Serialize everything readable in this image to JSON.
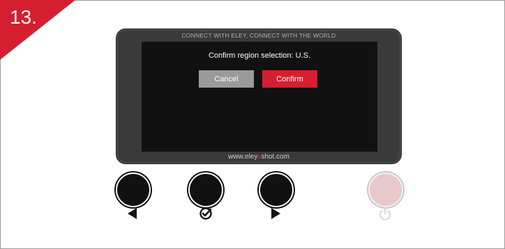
{
  "step": {
    "number": "13."
  },
  "device": {
    "top_text": "CONNECT WITH ELEY, CONNECT WITH THE WORLD",
    "url_prefix": "www.eley",
    "url_highlight": "x",
    "url_suffix": "shot.com"
  },
  "screen": {
    "message": "Confirm region selection: U.S.",
    "cancel_label": "Cancel",
    "confirm_label": "Confirm"
  },
  "controls": [
    {
      "name": "left-button",
      "icon": "left-arrow-icon"
    },
    {
      "name": "select-button",
      "icon": "check-circle-icon"
    },
    {
      "name": "right-button",
      "icon": "right-arrow-icon"
    },
    {
      "name": "power-button",
      "icon": "power-icon"
    }
  ],
  "colors": {
    "accent": "#d51f30",
    "cancel": "#9a9a9a",
    "screen": "#111111",
    "power_knob": "#e9c8cc"
  }
}
